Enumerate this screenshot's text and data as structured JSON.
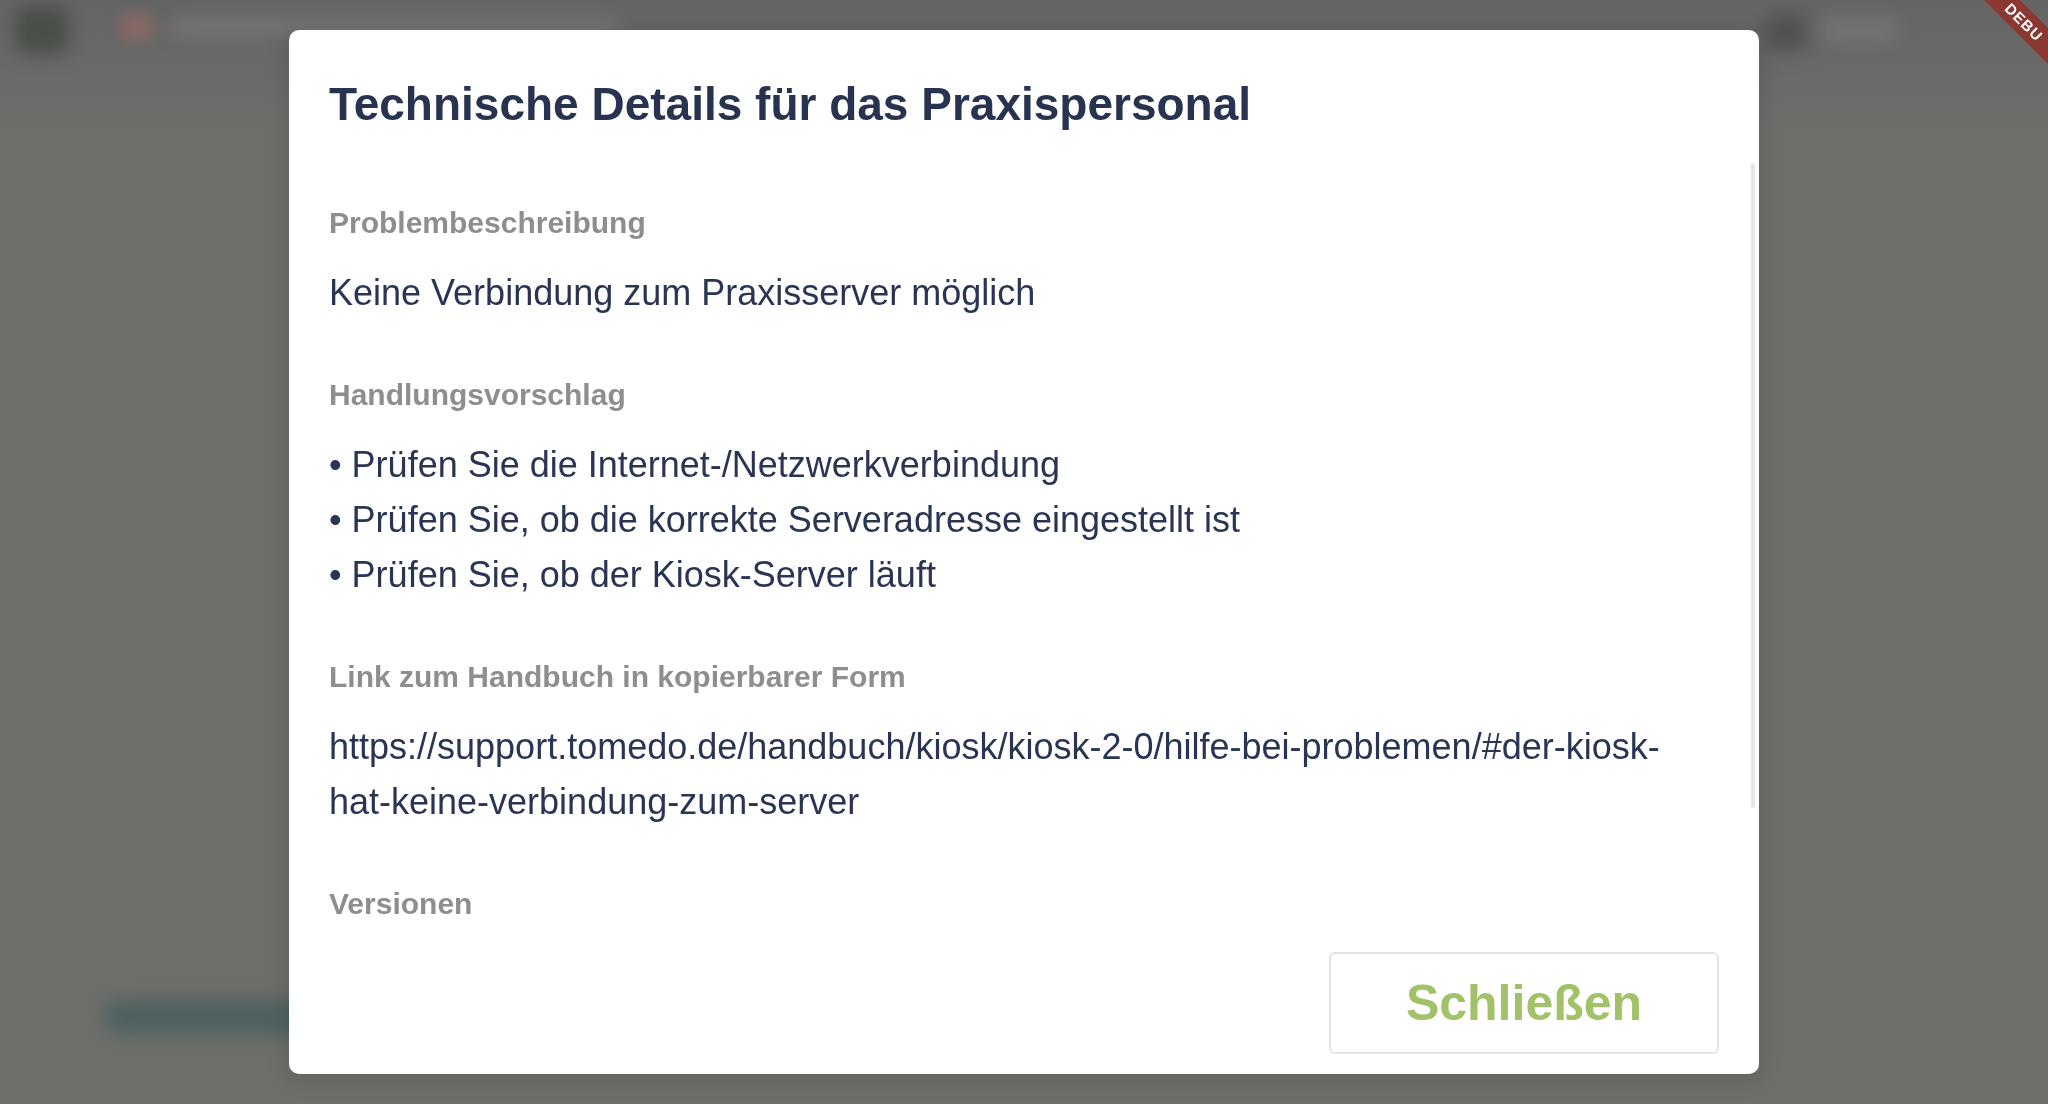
{
  "debug_banner": {
    "label": "DEBU"
  },
  "dialog": {
    "title": "Technische Details für das Praxispersonal",
    "sections": [
      {
        "heading": "Problembeschreibung",
        "lines": [
          "Keine Verbindung zum Praxisserver möglich"
        ]
      },
      {
        "heading": "Handlungsvorschlag",
        "lines": [
          "• Prüfen Sie die Internet-/Netzwerkverbindung",
          "• Prüfen Sie, ob die korrekte Serveradresse eingestellt ist",
          "• Prüfen Sie, ob der Kiosk-Server läuft"
        ]
      },
      {
        "heading": "Link zum Handbuch in kopierbarer Form",
        "lines": [
          "https://support.tomedo.de/handbuch/kiosk/kiosk-2-0/hilfe-bei-problemen/#der-kiosk-hat-keine-verbindung-zum-server"
        ]
      },
      {
        "heading": "Versionen"
      }
    ],
    "buttons": [
      {
        "label": "Schließen"
      }
    ]
  }
}
